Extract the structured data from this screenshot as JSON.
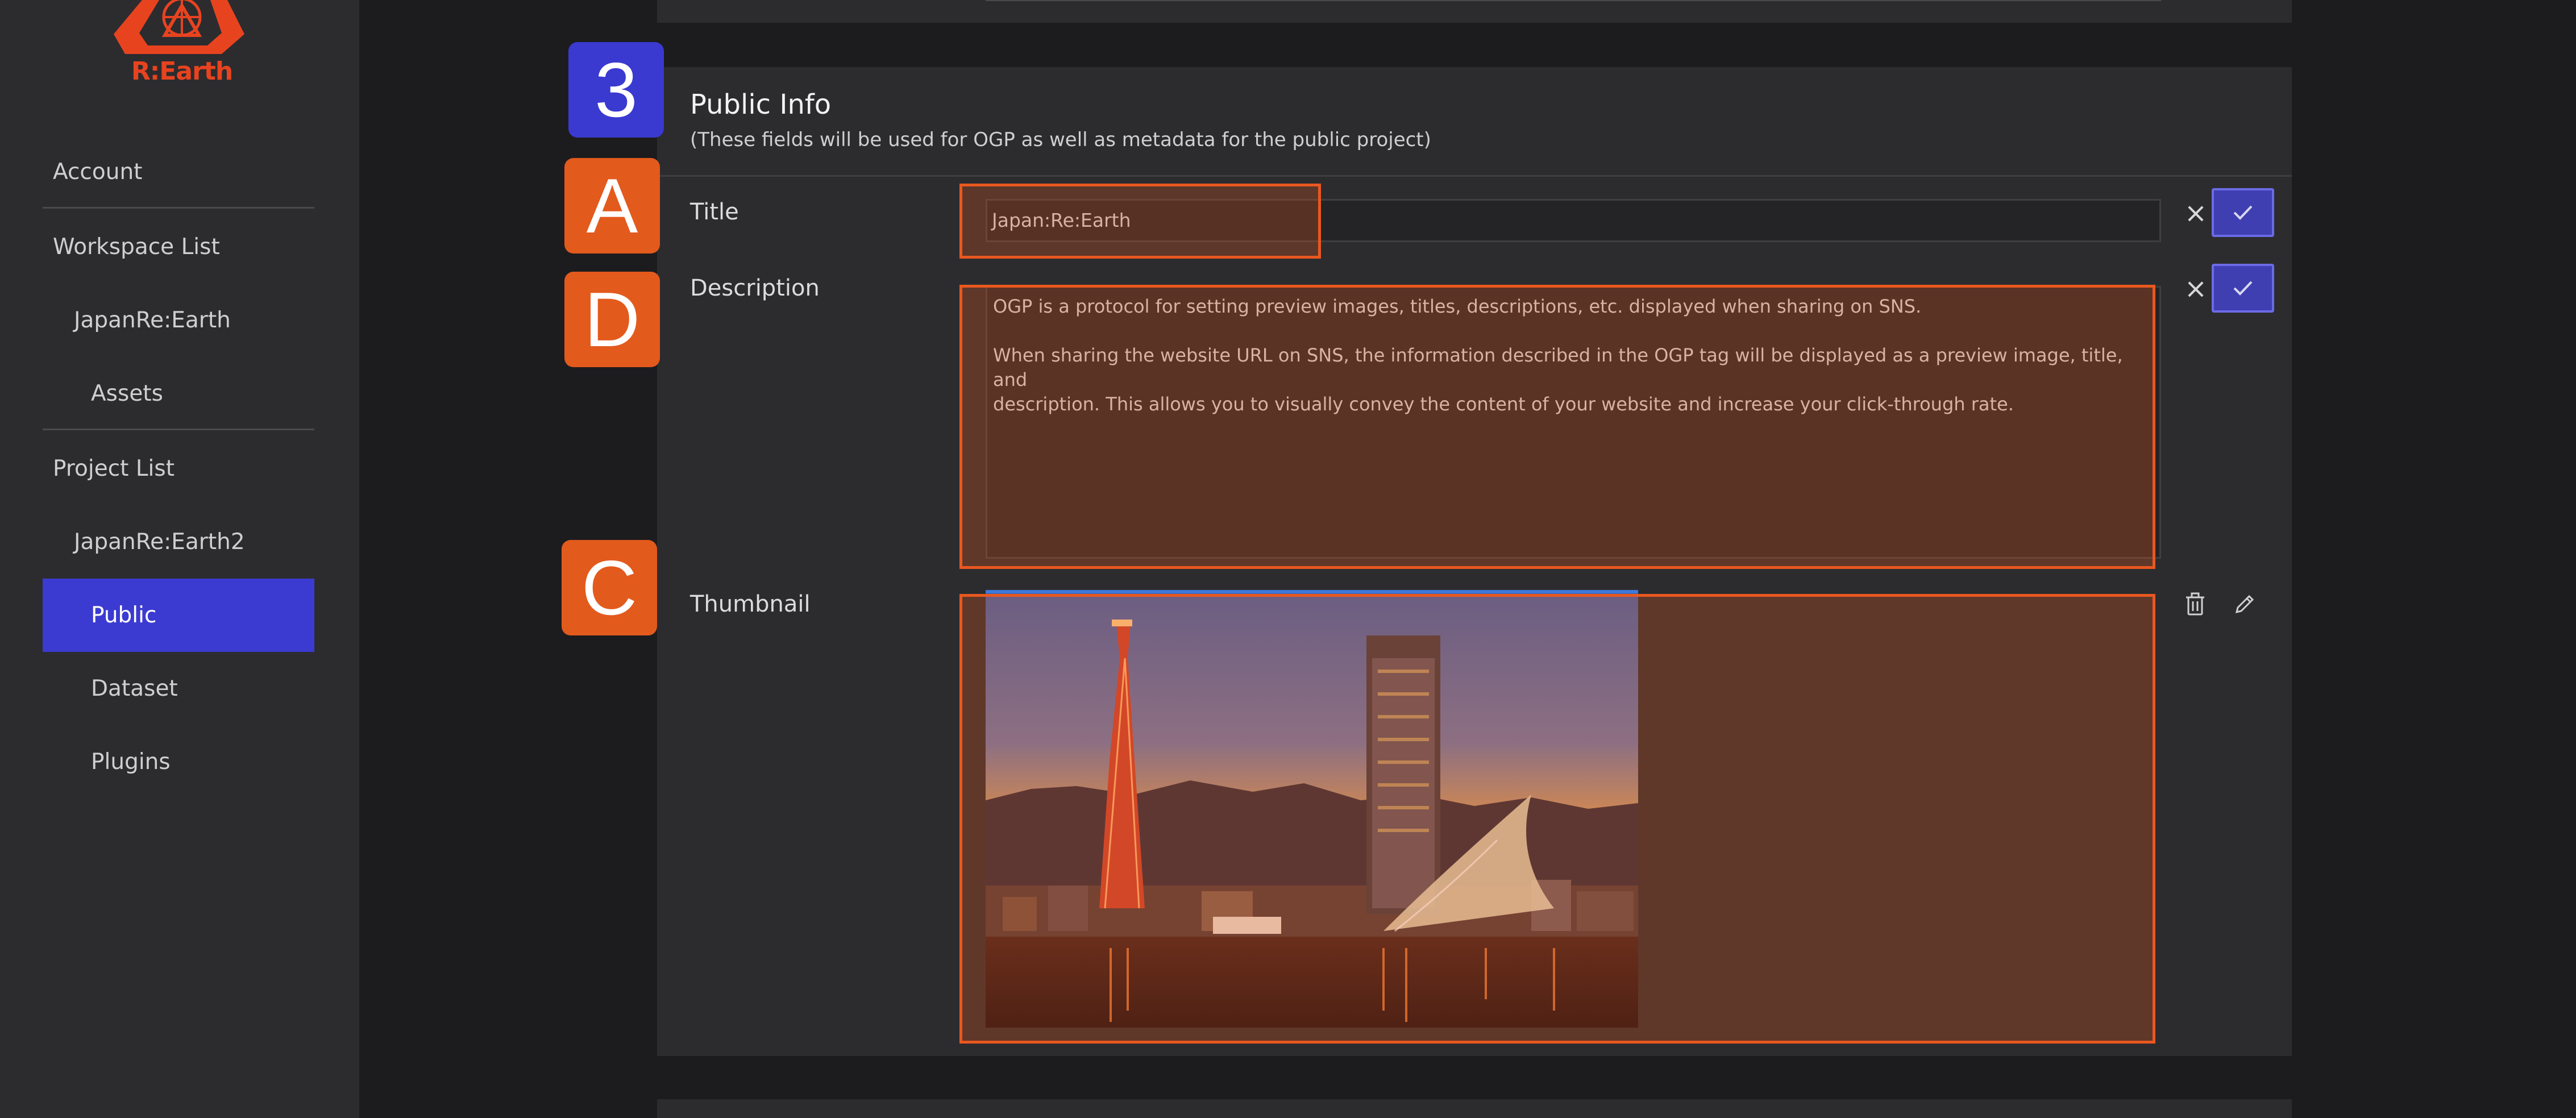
{
  "brand": {
    "name": "R:Earth",
    "color": "#e8431f"
  },
  "sidebar": {
    "items": [
      {
        "label": "Account"
      },
      {
        "label": "Workspace List"
      },
      {
        "label": "JapanRe:Earth"
      },
      {
        "label": "Assets"
      },
      {
        "label": "Project List"
      },
      {
        "label": "JapanRe:Earth2"
      },
      {
        "label": "Public",
        "active": true
      },
      {
        "label": "Dataset"
      },
      {
        "label": "Plugins"
      }
    ]
  },
  "public_info": {
    "title": "Public Info",
    "subtitle": "(These fields will be used for OGP as well as metadata for the public project)",
    "fields": {
      "title_label": "Title",
      "title_value": "Japan:Re:Earth",
      "description_label": "Description",
      "description_value": "OGP is a protocol for setting preview images, titles, descriptions, etc. displayed when sharing on SNS.\n\nWhen sharing the website URL on SNS, the information described in the OGP tag will be displayed as a preview image, title, and\ndescription. This allows you to visually convey the content of your website and increase your click-through rate.",
      "thumbnail_label": "Thumbnail",
      "thumbnail_image": "Kobe port tower and maritime museum at dusk"
    }
  },
  "annotations": {
    "step_badge": "3",
    "title_badge": "A",
    "description_badge": "D",
    "thumbnail_badge": "C"
  },
  "icons": {
    "cancel": "close-icon",
    "confirm": "check-icon",
    "delete": "trash-icon",
    "edit": "pencil-icon"
  },
  "colors": {
    "accent": "#3b3bd1",
    "highlight": "#e9581f",
    "background": "#1c1c1e",
    "panel": "#2c2c2f"
  }
}
